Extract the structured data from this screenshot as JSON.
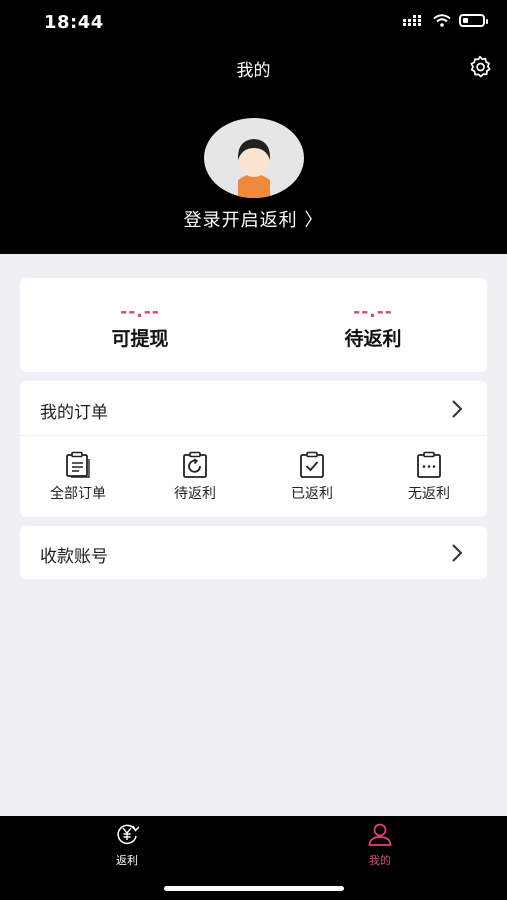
{
  "status_bar": {
    "time": "18:44"
  },
  "header": {
    "title": "我的",
    "login_text": "登录开启返利 〉"
  },
  "balance": {
    "withdrawable": {
      "value": "--.--",
      "label": "可提现"
    },
    "pending": {
      "value": "--.--",
      "label": "待返利"
    }
  },
  "orders": {
    "title": "我的订单",
    "items": [
      {
        "label": "全部订单",
        "icon": "clipboard-list-icon"
      },
      {
        "label": "待返利",
        "icon": "clipboard-refresh-icon"
      },
      {
        "label": "已返利",
        "icon": "clipboard-check-icon"
      },
      {
        "label": "无返利",
        "icon": "clipboard-dots-icon"
      }
    ]
  },
  "account": {
    "title": "收款账号"
  },
  "tabbar": {
    "items": [
      {
        "label": "返利",
        "icon": "rebate-icon",
        "active": false
      },
      {
        "label": "我的",
        "icon": "user-icon",
        "active": true
      }
    ]
  },
  "colors": {
    "accent": "#e0457b",
    "header_bg": "#000000",
    "page_bg": "#efeff4"
  }
}
